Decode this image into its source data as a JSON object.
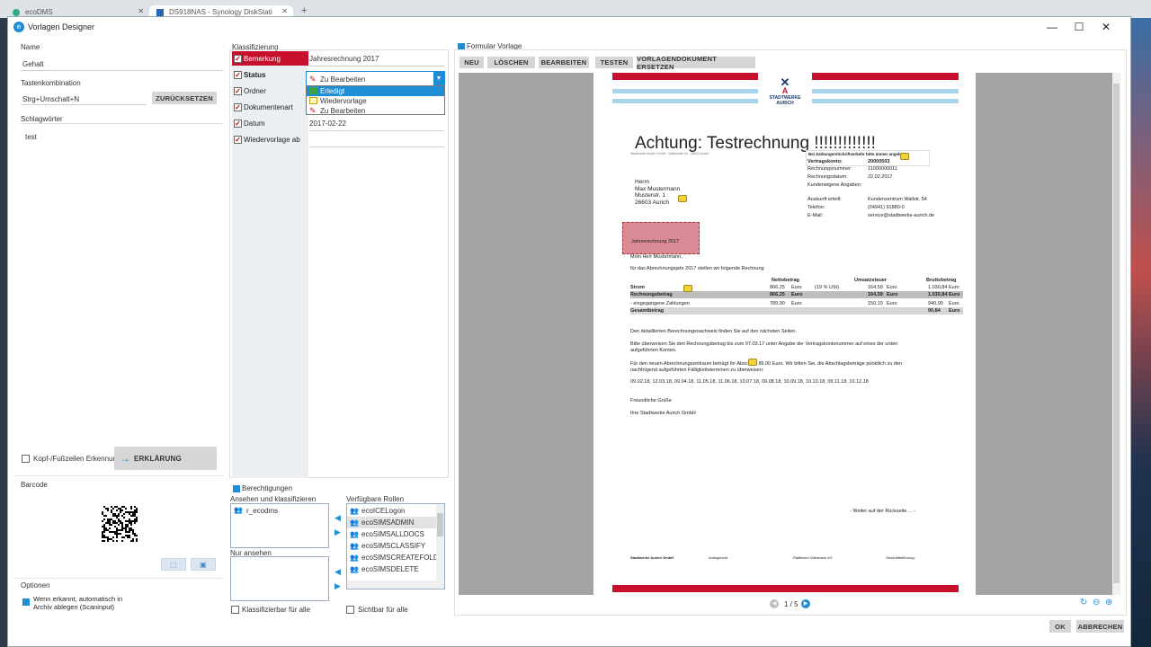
{
  "browser": {
    "tabs": [
      {
        "label": "ecoDMS"
      },
      {
        "label": "DS918NAS - Synology DiskStati"
      }
    ],
    "new_tab": "+"
  },
  "window": {
    "title": "Vorlagen Designer",
    "controls": [
      "—",
      "☐",
      "✕"
    ]
  },
  "left": {
    "name_label": "Name",
    "name_value": "Gehalt",
    "shortcut_label": "Tastenkombination",
    "shortcut_value": "Strg+Umschalt+N",
    "reset_button": "ZURÜCKSETZEN",
    "keywords_label": "Schlagwörter",
    "keywords_value": "test",
    "header_footer_label": "Kopf-/Fußzeilen Erkennung",
    "explain_button": "ERKLÄRUNG",
    "barcode_label": "Barcode",
    "options_label": "Optionen",
    "options_value": "Wenn erkannt, automatisch in Archiv ablegen (Scaninput)"
  },
  "classify": {
    "section_label": "Klassifizierung",
    "fields": [
      {
        "label": "Bemerkung",
        "value": "Jahresrechnung 2017"
      },
      {
        "label": "Status",
        "value": "Zu Bearbeiten"
      },
      {
        "label": "Ordner",
        "value": ""
      },
      {
        "label": "Dokumentenart",
        "value": ""
      },
      {
        "label": "Datum",
        "value": "2017-02-22"
      },
      {
        "label": "Wiedervorlage ab",
        "value": ""
      }
    ],
    "dropdown_options": [
      "Erledigt",
      "Wiedervorlage",
      "Zu Bearbeiten"
    ]
  },
  "perms": {
    "section_label": "Berechtigungen",
    "view_classify_label": "Ansehen und klassifizieren",
    "view_classify_items": [
      "r_ecodms"
    ],
    "view_only_label": "Nur ansehen",
    "roles_label": "Verfügbare Rollen",
    "roles": [
      "ecoICELogon",
      "ecoSIMSADMIN",
      "ecoSIMSALLDOCS",
      "ecoSIMSCLASSIFY",
      "ecoSIMSCREATEFOLDER",
      "ecoSIMSDELETE"
    ],
    "classifiable_all": "Klassifizierbar für alle",
    "visible_all": "Sichtbar für alle"
  },
  "preview": {
    "section_label": "Formular Vorlage",
    "toolbar": [
      "NEU",
      "LÖSCHEN",
      "BEARBEITEN",
      "TESTEN",
      "VORLAGENDOKUMENT ERSETZEN"
    ],
    "pager": "1 / 5"
  },
  "doc": {
    "brand": "STADTWERKE\nAURICH",
    "brand_line1": "STADTWERKE",
    "brand_line2": "AURICH",
    "headline": "Achtung:  Testrechnung !!!!!!!!!!!!!",
    "sender_line": "Stadtwerke Aurich GmbH · Wallstraße 54 · 26603 Aurich",
    "recipient": [
      "Herrn",
      "Max Mustermann",
      "Musterstr. 1",
      "26603 Aurich"
    ],
    "info_header": "Bei Zahlungen/Schriftverkehr bitte immer angeben!",
    "info": [
      [
        "Vertragskonto:",
        "20000503"
      ],
      [
        "Rechnungsnummer:",
        "11000000011"
      ],
      [
        "Rechnungsdatum:",
        "22.02.2017"
      ],
      [
        "Kundeneigene Angaben:",
        ""
      ],
      [
        "Auskunft erteilt:",
        "Kundenzentrum Wallstr. 54"
      ],
      [
        "Telefon:",
        "(04941) 91880-0"
      ],
      [
        "E-Mail:",
        "service@stadtwerke-aurich.de"
      ]
    ],
    "highlight": "Jahresrechnung 2017",
    "greeting": "Moin Herr Mustermann,",
    "intro": "für das Abrechnungsjahr 2017 stellen wir folgende Rechnung",
    "table_headers": [
      "Nettobetrag",
      "Umsatzsteuer",
      "Bruttobetrag"
    ],
    "table_rows": [
      [
        "Strom",
        "866,25",
        "Euro",
        "(19 % USt)",
        "164,59",
        "Euro",
        "1.030,84",
        "Euro"
      ],
      [
        "Rechnungsbetrag",
        "866,25",
        "Euro",
        "",
        "164,59",
        "Euro",
        "1.030,84",
        "Euro"
      ],
      [
        "- eingegangene Zahlungen",
        "789,90",
        "Euro",
        "",
        "150,10",
        "Euro",
        "940,00",
        "Euro"
      ],
      [
        "Gesamtbetrag",
        "",
        "",
        "",
        "",
        "",
        "90,84",
        "Euro"
      ]
    ],
    "para1": "Den detaillierten Berechnungsnachweis finden Sie auf den nächsten Seiten.",
    "para2a": "Bitte überweisen Sie den Rechnungsbetrag bis zum 07.03.17 unter Angabe der Vertragskontonummer auf eines der unten",
    "para2b": "aufgeführten Konten.",
    "para3a": "Für den neuen Abrechnungszeitraum beträgt Ihr Abschlag 86,00 Euro. Wir bitten Sie, die Abschlagsbeträge pünktlich zu den",
    "para3b": "nachfolgend aufgeführten Fälligkeitsterminen zu überweisen:",
    "dates": "09.02.18, 12.03.18, 09.04.18, 11.05.18, 11.06.18, 10.07.18, 09.08.18, 10.09.18, 10.10.18, 09.11.18, 10.12.18",
    "closing": "Freundliche Grüße",
    "signature": "Ihre Stadtwerke Aurich GmbH",
    "continue": "- Weiter auf der Rückseite ... -",
    "footer_cols": [
      "Stadtwerke Aurich GmbH",
      "Amtsgericht",
      "Raiffeisen Volksbank eG",
      "Geschäftsführung:"
    ]
  },
  "buttons": {
    "ok": "OK",
    "cancel": "ABBRECHEN"
  },
  "colors": {
    "accent": "#1f8dd6",
    "brand_red": "#c8102e",
    "highlight": "#d98a94"
  }
}
